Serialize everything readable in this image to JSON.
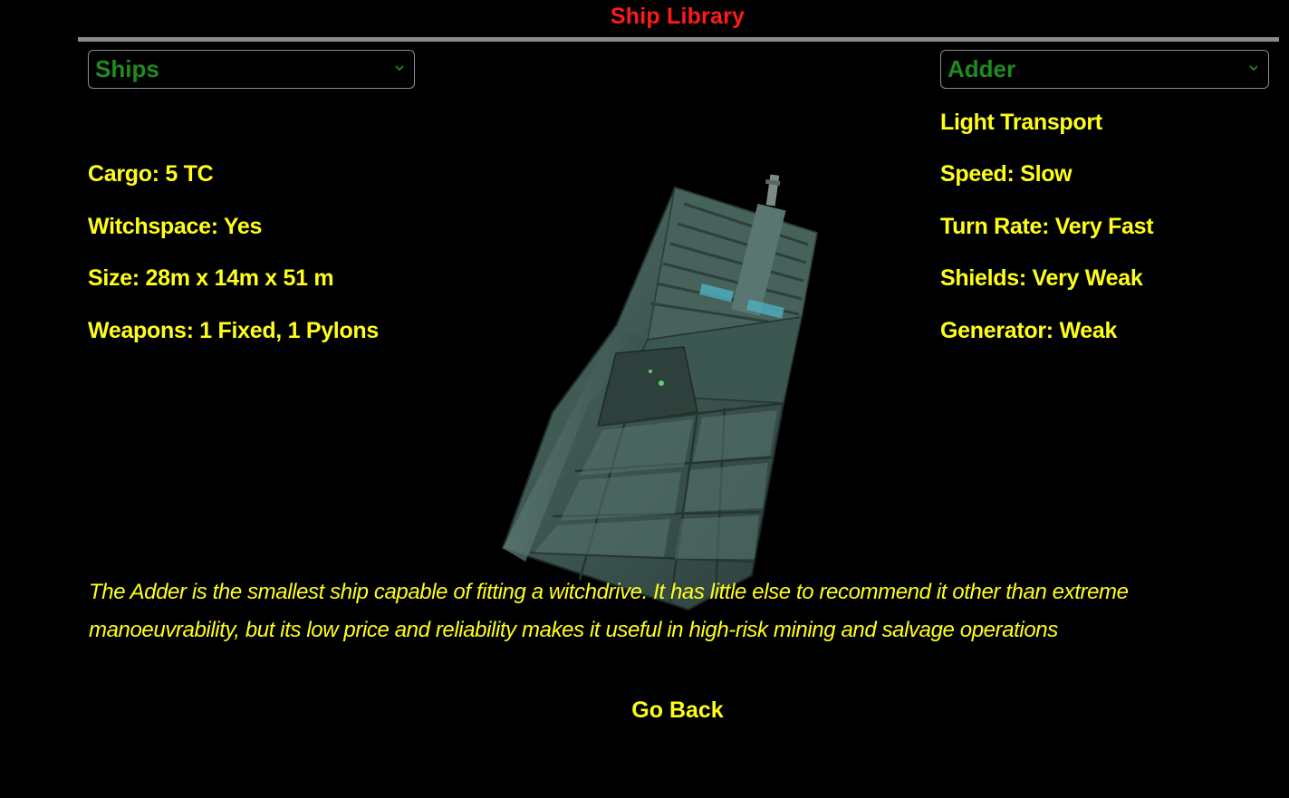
{
  "header": {
    "title": "Ship Library"
  },
  "selectors": {
    "category": {
      "value": "Ships",
      "icon": "chevron-down-icon"
    },
    "ship": {
      "value": "Adder",
      "icon": "chevron-down-icon"
    }
  },
  "ship": {
    "role": "Light Transport",
    "left_stats": [
      "Cargo: 5 TC",
      "Witchspace: Yes",
      "Size: 28m x 14m x 51 m",
      "Weapons: 1 Fixed, 1 Pylons"
    ],
    "right_stats": [
      "Speed: Slow",
      "Turn Rate: Very Fast",
      "Shields: Very Weak",
      "Generator: Weak"
    ],
    "description": "The Adder is the smallest ship capable of fitting a witchdrive. It has little else to recommend it other than extreme manoeuvrability, but its low price and reliability makes it useful in high-risk mining and salvage operations"
  },
  "footer": {
    "go_back_label": "Go Back"
  },
  "colors": {
    "title": "#ff1a1a",
    "text": "#ffff1a",
    "dropdown_text": "#1f8a1f",
    "background": "#000000",
    "rule": "#8a8a8a"
  }
}
